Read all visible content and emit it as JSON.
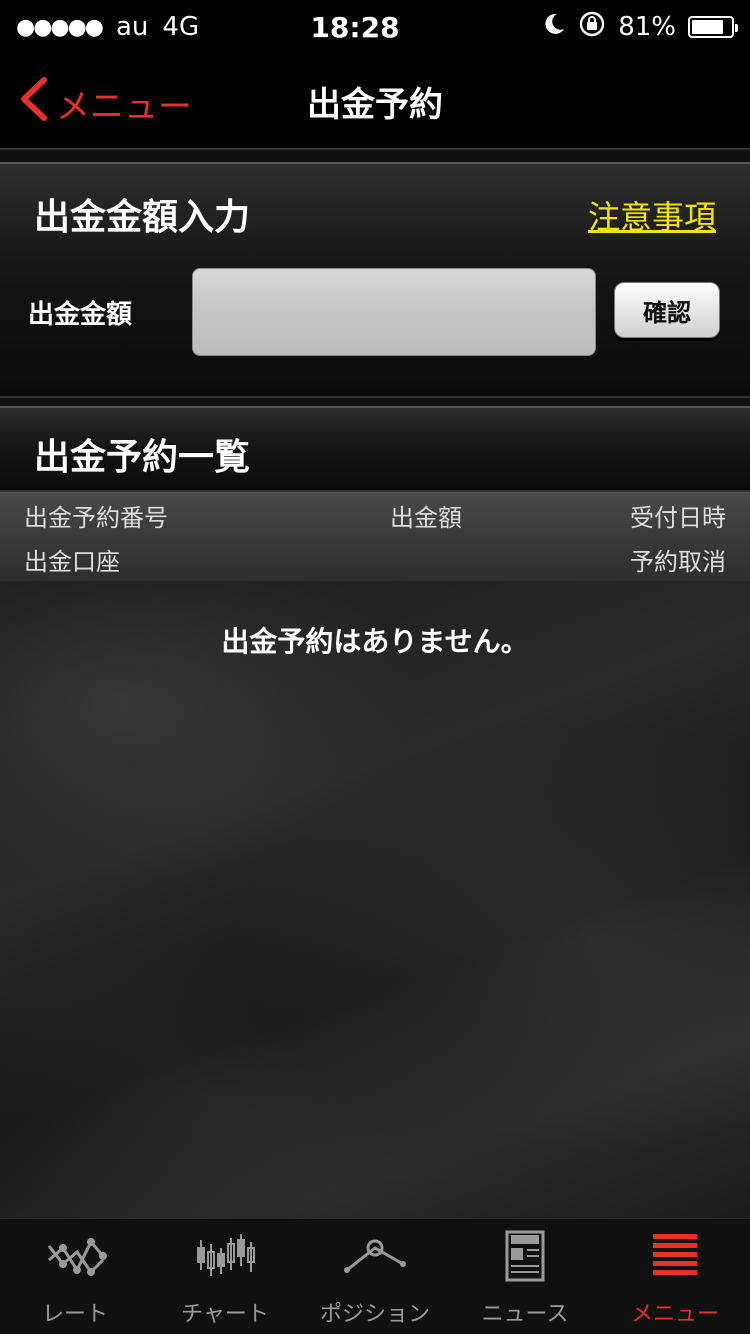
{
  "status": {
    "dots": "●●●●●",
    "carrier": "au",
    "network": "4G",
    "time": "18:28",
    "battery_text": "81%",
    "battery_level": 0.81
  },
  "nav": {
    "back_label": "メニュー",
    "title": "出金予約"
  },
  "input_section": {
    "title": "出金金額入力",
    "notice_link": "注意事項",
    "amount_label": "出金金額",
    "amount_value": "",
    "amount_placeholder": "",
    "confirm_label": "確認"
  },
  "list_section": {
    "title": "出金予約一覧",
    "columns_row1": [
      "出金予約番号",
      "出金額",
      "受付日時"
    ],
    "columns_row2": [
      "出金口座",
      "予約取消"
    ],
    "empty_message": "出金予約はありません。"
  },
  "tabs": [
    {
      "label": "レート",
      "icon": "rate-icon"
    },
    {
      "label": "チャート",
      "icon": "candlestick-chart-icon"
    },
    {
      "label": "ポジション",
      "icon": "position-icon"
    },
    {
      "label": "ニュース",
      "icon": "news-icon"
    },
    {
      "label": "メニュー",
      "icon": "menu-list-icon",
      "active": true
    }
  ],
  "colors": {
    "accent_red": "#e8302a",
    "link_yellow": "#f3e400"
  }
}
